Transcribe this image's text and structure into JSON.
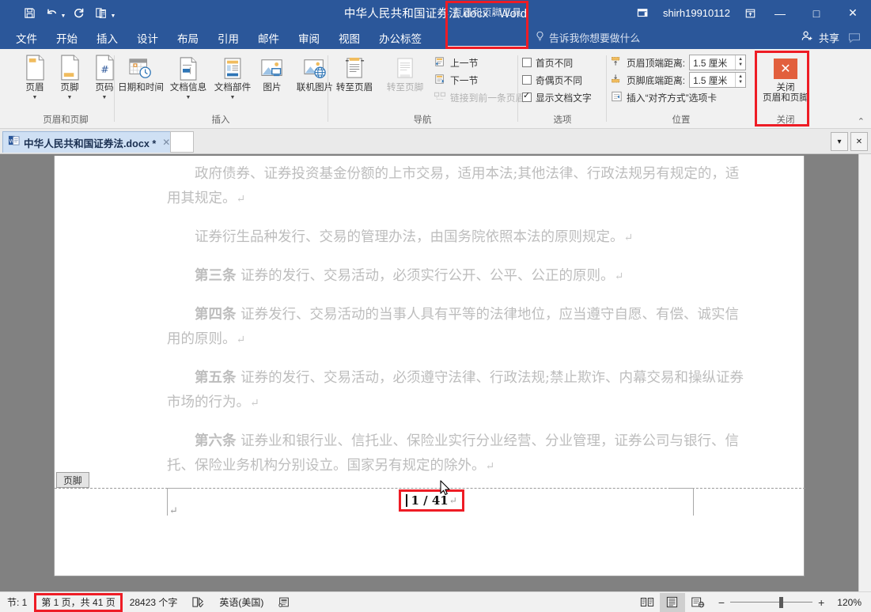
{
  "titlebar": {
    "document_title": "中华人民共和国证券法.docx  -  Word",
    "quick_access": [
      {
        "name": "save-icon",
        "label": "保存"
      },
      {
        "name": "undo-icon",
        "label": "撤消"
      },
      {
        "name": "redo-icon",
        "label": "恢复"
      },
      {
        "name": "format-painter-icon",
        "label": "重复"
      },
      {
        "name": "customize-qat-icon",
        "label": "自定义快速访问工具栏"
      }
    ],
    "contextual_tool_label": "页眉和页脚工具",
    "user_name": "shirh19910112",
    "ribbon_display_icon": "ribbon-display-options-icon",
    "restore_down_icon": "restore-icon",
    "minimize_label": "—",
    "maximize_label": "□",
    "close_label": "✕"
  },
  "tabs": [
    {
      "label": "文件",
      "name": "tab-file"
    },
    {
      "label": "开始",
      "name": "tab-home"
    },
    {
      "label": "插入",
      "name": "tab-insert"
    },
    {
      "label": "设计",
      "name": "tab-design"
    },
    {
      "label": "布局",
      "name": "tab-layout"
    },
    {
      "label": "引用",
      "name": "tab-references"
    },
    {
      "label": "邮件",
      "name": "tab-mailings"
    },
    {
      "label": "审阅",
      "name": "tab-review"
    },
    {
      "label": "视图",
      "name": "tab-view"
    },
    {
      "label": "办公标签",
      "name": "tab-office-tab"
    }
  ],
  "contextual_tab": {
    "label": "设计",
    "active": true
  },
  "tellme": {
    "placeholder": "告诉我你想要做什么"
  },
  "share": {
    "label": "共享"
  },
  "ribbon": {
    "group_header_footer": {
      "title": "页眉和页脚",
      "buttons": [
        {
          "label": "页眉",
          "icon": "header-icon"
        },
        {
          "label": "页脚",
          "icon": "footer-icon"
        },
        {
          "label": "页码",
          "icon": "page-number-icon"
        }
      ]
    },
    "group_insert": {
      "title": "插入",
      "buttons": [
        {
          "label": "日期和时间",
          "icon": "date-time-icon"
        },
        {
          "label": "文档信息",
          "icon": "document-info-icon"
        },
        {
          "label": "文档部件",
          "icon": "quick-parts-icon"
        },
        {
          "label": "图片",
          "icon": "picture-icon"
        },
        {
          "label": "联机图片",
          "icon": "online-picture-icon"
        }
      ]
    },
    "group_navigation": {
      "title": "导航",
      "goto_header": "转至页眉",
      "goto_footer": "转至页脚",
      "previous_section": "上一节",
      "next_section": "下一节",
      "link_to_previous": "链接到前一条页眉"
    },
    "group_options": {
      "title": "选项",
      "items": [
        {
          "label": "首页不同",
          "checked": false
        },
        {
          "label": "奇偶页不同",
          "checked": false
        },
        {
          "label": "显示文档文字",
          "checked": true
        }
      ]
    },
    "group_position": {
      "title": "位置",
      "header_from_top_label": "页眉顶端距离:",
      "header_from_top_value": "1.5 厘米",
      "footer_from_bottom_label": "页脚底端距离:",
      "footer_from_bottom_value": "1.5 厘米",
      "insert_alignment_tab": "插入“对齐方式”选项卡"
    },
    "group_close": {
      "title": "关闭",
      "button_line1": "关闭",
      "button_line2": "页眉和页脚"
    },
    "collapse_ribbon_icon": "chevron-up-icon"
  },
  "doctabbar": {
    "tab_label": "中华人民共和国证券法.docx *",
    "tab_close": "✕",
    "dropdown": "▾",
    "close_all": "✕"
  },
  "document": {
    "paragraphs": [
      {
        "bold": "",
        "text": "政府债券、证券投资基金份额的上市交易，适用本法;其他法律、行政法规另有规定的，适用其规定。"
      },
      {
        "bold": "",
        "text": "证券衍生品种发行、交易的管理办法，由国务院依照本法的原则规定。"
      },
      {
        "bold": "第三条",
        "text": "  证券的发行、交易活动，必须实行公开、公平、公正的原则。"
      },
      {
        "bold": "第四条",
        "text": "  证券发行、交易活动的当事人具有平等的法律地位，应当遵守自愿、有偿、诚实信用的原则。"
      },
      {
        "bold": "第五条",
        "text": "  证券的发行、交易活动，必须遵守法律、行政法规;禁止欺诈、内幕交易和操纵证券市场的行为。"
      },
      {
        "bold": "第六条",
        "text": "  证券业和银行业、信托业、保险业实行分业经营、分业管理，证券公司与银行、信托、保险业务机构分别设立。国家另有规定的除外。"
      }
    ],
    "pilcrow": "↵",
    "footer_tag_label": "页脚",
    "footer_page_number": "1 / 41"
  },
  "statusbar": {
    "section": "节: 1",
    "page_indicator": "第 1 页，共 41 页",
    "word_count": "28423 个字",
    "proofing_icon": "proofing-icon",
    "language": "英语(美国)",
    "macro_icon": "macro-record-icon",
    "views": [
      {
        "name": "read-mode-icon",
        "active": false
      },
      {
        "name": "print-layout-icon",
        "active": true
      },
      {
        "name": "web-layout-icon",
        "active": false
      }
    ],
    "zoom_out": "−",
    "zoom_in": "+",
    "zoom_level": "120%"
  },
  "colors": {
    "brand_blue": "#2b579a",
    "highlight_red": "#ee1c25",
    "close_orange": "#e25f3d",
    "doc_gray_text": "#bdbdbd"
  }
}
